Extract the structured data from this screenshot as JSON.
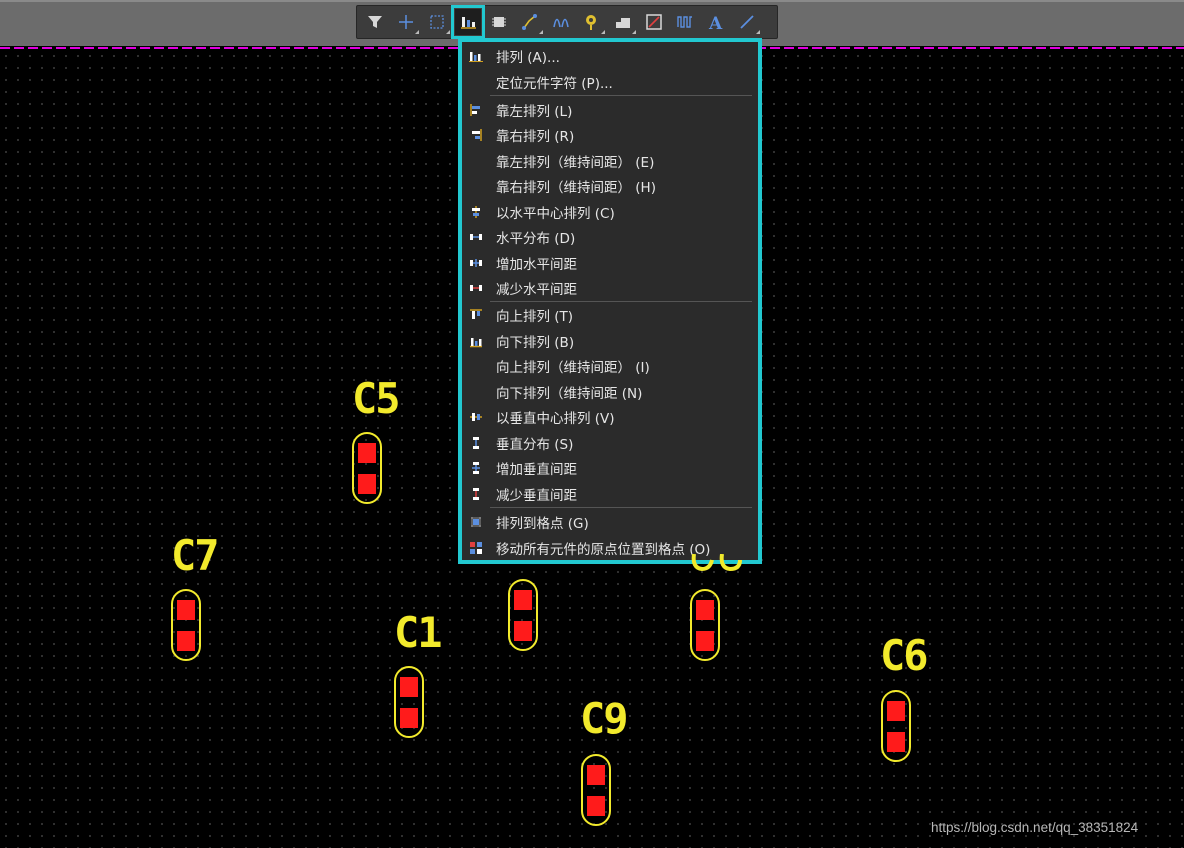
{
  "menu": {
    "items": [
      {
        "label": "排列 (A)...",
        "icon": "align-icon"
      },
      {
        "label": "定位元件字符 (P)...",
        "icon": ""
      },
      {
        "label": "靠左排列 (L)",
        "icon": "align-left-icon"
      },
      {
        "label": "靠右排列 (R)",
        "icon": "align-right-icon"
      },
      {
        "label": "靠左排列（维持间距） (E)",
        "icon": ""
      },
      {
        "label": "靠右排列（维持间距） (H)",
        "icon": ""
      },
      {
        "label": "以水平中心排列 (C)",
        "icon": "align-horizontal-center-icon"
      },
      {
        "label": "水平分布 (D)",
        "icon": "distribute-horizontal-icon"
      },
      {
        "label": "增加水平间距",
        "icon": "increase-horizontal-spacing-icon"
      },
      {
        "label": "减少水平间距",
        "icon": "decrease-horizontal-spacing-icon"
      },
      {
        "label": "向上排列 (T)",
        "icon": "align-top-icon"
      },
      {
        "label": "向下排列 (B)",
        "icon": "align-bottom-icon"
      },
      {
        "label": "向上排列（维持间距） (I)",
        "icon": ""
      },
      {
        "label": "向下排列（维持间距 (N)",
        "icon": ""
      },
      {
        "label": "以垂直中心排列 (V)",
        "icon": "align-vertical-center-icon"
      },
      {
        "label": "垂直分布 (S)",
        "icon": "distribute-vertical-icon"
      },
      {
        "label": "增加垂直间距",
        "icon": "increase-vertical-spacing-icon"
      },
      {
        "label": "减少垂直间距",
        "icon": "decrease-vertical-spacing-icon"
      },
      {
        "label": "排列到格点 (G)",
        "icon": "align-to-grid-icon"
      },
      {
        "label": "移动所有元件的原点位置到格点 (O)",
        "icon": "move-origin-to-grid-icon"
      }
    ]
  },
  "components": {
    "c5": "C5",
    "c7": "C7",
    "c1": "C1",
    "c9": "C9",
    "c6": "C6"
  },
  "watermark": "https://blog.csdn.net/qq_38351824",
  "colors": {
    "highlight": "#22c8d0",
    "silkscreen": "#f2ea2c",
    "pad": "#ff1b1b",
    "board_edge": "#e000e0"
  }
}
